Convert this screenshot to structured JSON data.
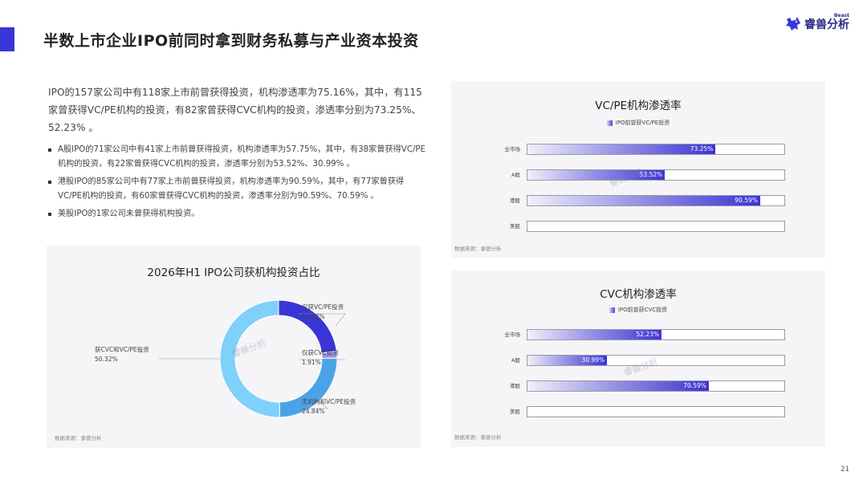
{
  "header": {
    "title": "半数上市企业IPO前同时拿到财务私募与产业资本投资",
    "logo_text": "睿兽分析",
    "logo_superscript": "Beast"
  },
  "summary": "IPO的157家公司中有118家上市前曾获得投资，机构渗透率为75.16%，其中，有115家曾获得VC/PE机构的投资，有82家曾获得CVC机构的投资，渗透率分别为73.25%、52.23% 。",
  "bullets": [
    "A股IPO的71家公司中有41家上市前曾获得投资，机构渗透率为57.75%，其中，有38家曾获得VC/PE机构的投资，有22家曾获得CVC机构的投资，渗透率分别为53.52%、30.99% 。",
    "港股IPO的85家公司中有77家上市前曾获得投资，机构渗透率为90.59%，其中，有77家曾获得VC/PE机构的投资，有60家曾获得CVC机构的投资，渗透率分别为90.59%、70.59% 。",
    "美股IPO的1家公司未曾获得机构投资。"
  ],
  "watermark": "睿兽分析",
  "source_text": "数据来源：睿兽分析",
  "page_number": "21",
  "colors": {
    "accent": "#3a35d6",
    "donut_vcpe_only": "#3a35d6",
    "donut_cvc_only": "#9b97e6",
    "donut_none": "#4aa3e8",
    "donut_both": "#7fd0fa"
  },
  "chart_data": [
    {
      "type": "pie",
      "title": "2026年H1 IPO公司获机构投资占比",
      "donut": true,
      "slices": [
        {
          "label": "仅获VC/PE投资",
          "value": 22.93,
          "display": "22.93%"
        },
        {
          "label": "仅获CVC投资",
          "value": 1.91,
          "display": "1.91%"
        },
        {
          "label": "无机构和VC/PE投资",
          "value": 24.84,
          "display": "24.84%"
        },
        {
          "label": "获CVC和VC/PE投资",
          "value": 50.32,
          "display": "50.32%"
        }
      ]
    },
    {
      "type": "bar",
      "orientation": "horizontal",
      "title": "VC/PE机构渗透率",
      "legend": "IPO前曾获VC/PE投资",
      "categories": [
        "全市场",
        "A股",
        "港股",
        "美股"
      ],
      "values": [
        73.25,
        53.52,
        90.59,
        0
      ],
      "labels": [
        "73.25%",
        "53.52%",
        "90.59%",
        ""
      ],
      "xlim": [
        0,
        100
      ]
    },
    {
      "type": "bar",
      "orientation": "horizontal",
      "title": "CVC机构渗透率",
      "legend": "IPO前曾获CVC投资",
      "categories": [
        "全市场",
        "A股",
        "港股",
        "美股"
      ],
      "values": [
        52.23,
        30.99,
        70.59,
        0
      ],
      "labels": [
        "52.23%",
        "30.99%",
        "70.59%",
        ""
      ],
      "xlim": [
        0,
        100
      ]
    }
  ]
}
